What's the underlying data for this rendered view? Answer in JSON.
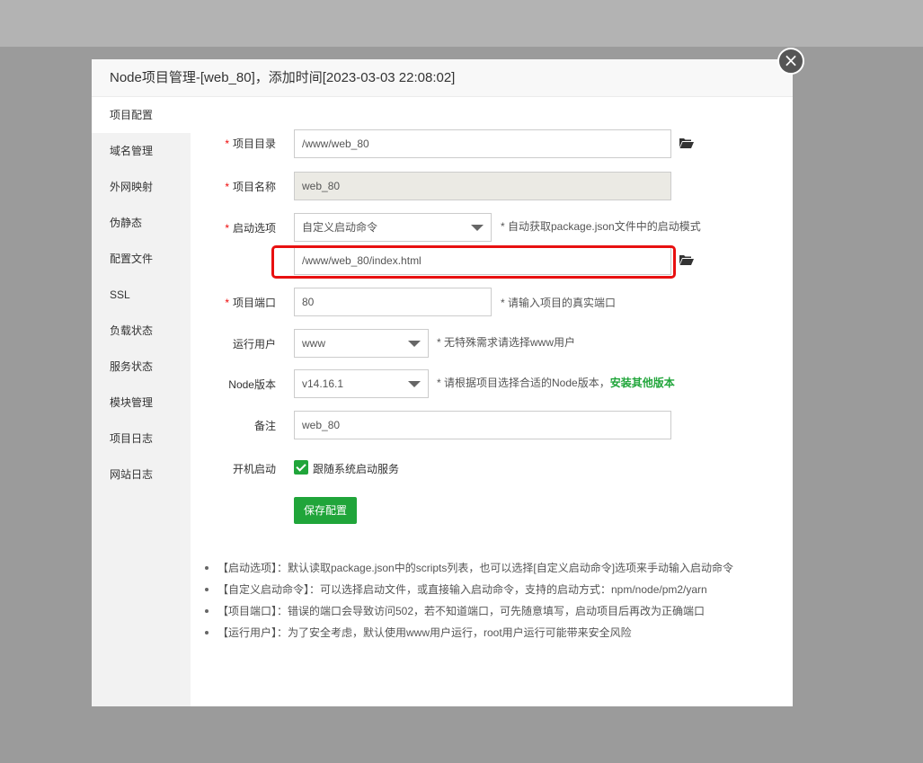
{
  "dialog": {
    "title": "Node项目管理-[web_80]，添加时间[2023-03-03 22:08:02]",
    "close_glyph": "×"
  },
  "sidebar": {
    "items": [
      {
        "label": "项目配置",
        "active": true
      },
      {
        "label": "域名管理"
      },
      {
        "label": "外网映射"
      },
      {
        "label": "伪静态"
      },
      {
        "label": "配置文件"
      },
      {
        "label": "SSL"
      },
      {
        "label": "负载状态"
      },
      {
        "label": "服务状态"
      },
      {
        "label": "模块管理"
      },
      {
        "label": "项目日志"
      },
      {
        "label": "网站日志"
      }
    ]
  },
  "form": {
    "required_mark": "*",
    "project_dir": {
      "label": "项目目录",
      "value": "/www/web_80",
      "icon": "folder-open-icon"
    },
    "project_name": {
      "label": "项目名称",
      "value": "web_80"
    },
    "start_option": {
      "label": "启动选项",
      "selected": "自定义启动命令",
      "hint": "* 自动获取package.json文件中的启动模式"
    },
    "start_file": {
      "value": "/www/web_80/index.html",
      "icon": "folder-open-icon"
    },
    "project_port": {
      "label": "项目端口",
      "value": "80",
      "hint": "* 请输入项目的真实端口"
    },
    "run_user": {
      "label": "运行用户",
      "selected": "www",
      "hint": "* 无特殊需求请选择www用户"
    },
    "node_version": {
      "label": "Node版本",
      "selected": "v14.16.1",
      "hint": "* 请根据项目选择合适的Node版本，",
      "link": "安装其他版本"
    },
    "remark": {
      "label": "备注",
      "value": "web_80"
    },
    "autostart": {
      "label": "开机启动",
      "checkbox_label": "跟随系统启动服务",
      "checked": true
    },
    "save_label": "保存配置"
  },
  "colors": {
    "accent": "#20a53a",
    "required": "#ef0808",
    "highlight": "#e81010"
  },
  "tips": [
    "【启动选项】：默认读取package.json中的scripts列表，也可以选择[自定义启动命令]选项来手动输入启动命令",
    "【自定义启动命令】：可以选择启动文件，或直接输入启动命令，支持的启动方式：npm/node/pm2/yarn",
    "【项目端口】：错误的端口会导致访问502，若不知道端口，可先随意填写，启动项目后再改为正确端口",
    "【运行用户】：为了安全考虑，默认使用www用户运行，root用户运行可能带来安全风险"
  ]
}
